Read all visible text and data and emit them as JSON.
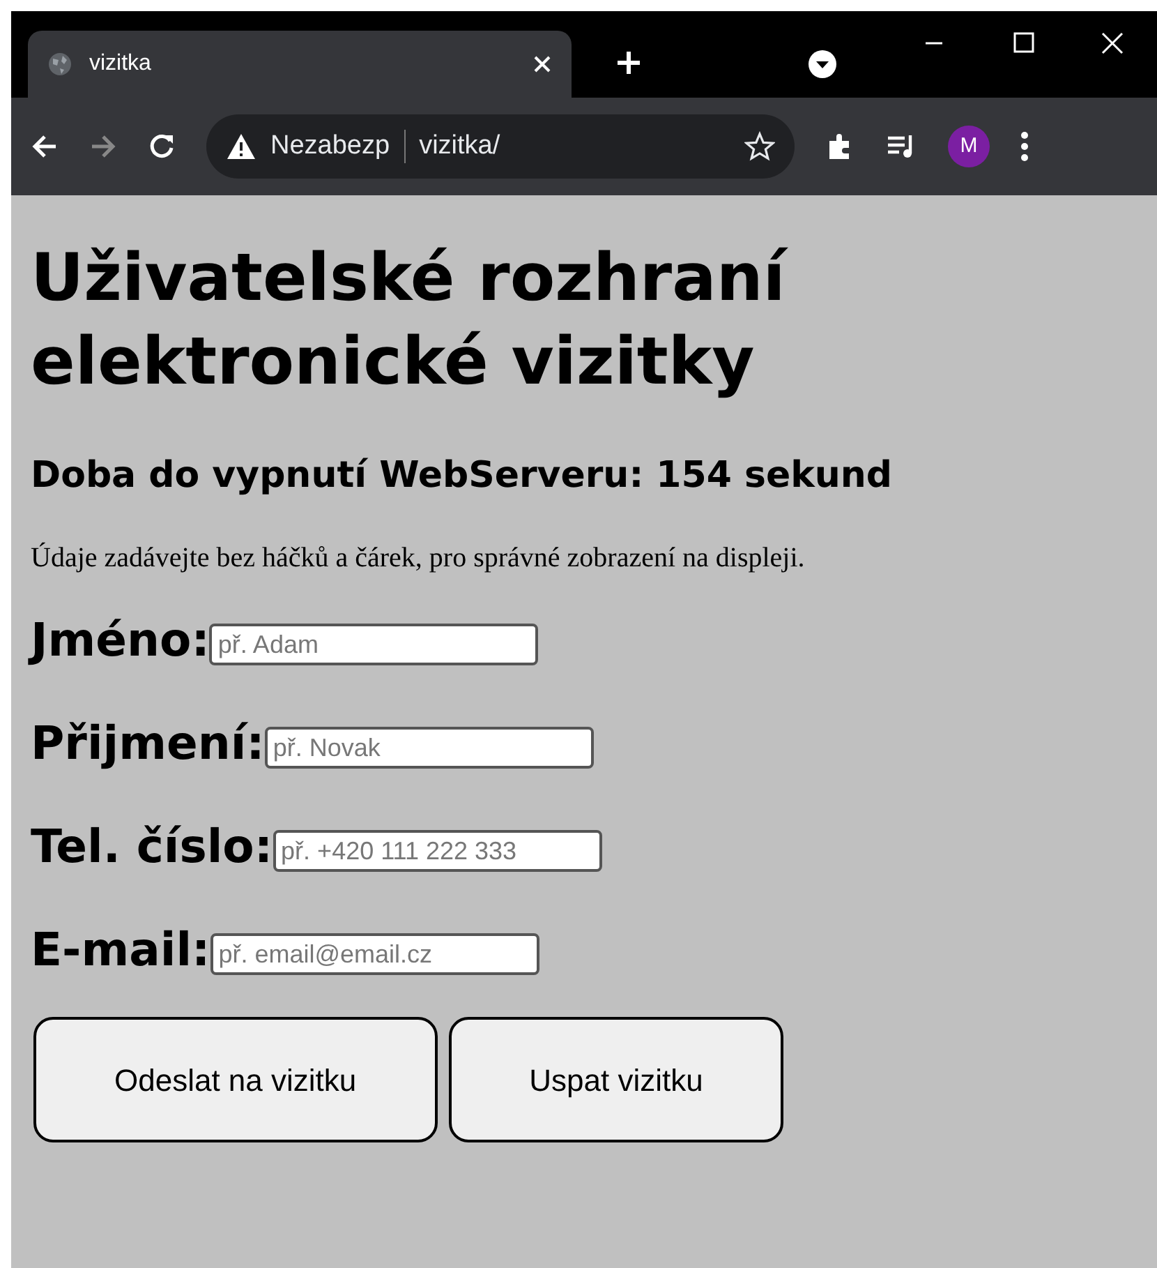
{
  "browser": {
    "tab_title": "vizitka",
    "address_security": "Nezabezp",
    "address_url": "vizitka/",
    "profile_initial": "M"
  },
  "page": {
    "title": "Uživatelské rozhraní elektronické vizitky",
    "countdown": "Doba do vypnutí WebServeru: 154 sekund",
    "note": "Údaje zadávejte bez háčků a čárek, pro správné zobrazení na displeji.",
    "fields": [
      {
        "label": "Jméno:",
        "placeholder": "př. Adam"
      },
      {
        "label": "Přijmení:",
        "placeholder": "př. Novak"
      },
      {
        "label": "Tel. číslo:",
        "placeholder": "př. +420 111 222 333"
      },
      {
        "label": "E-mail:",
        "placeholder": "př. email@email.cz"
      }
    ],
    "buttons": [
      "Odeslat na vizitku",
      "Uspat vizitku"
    ]
  }
}
